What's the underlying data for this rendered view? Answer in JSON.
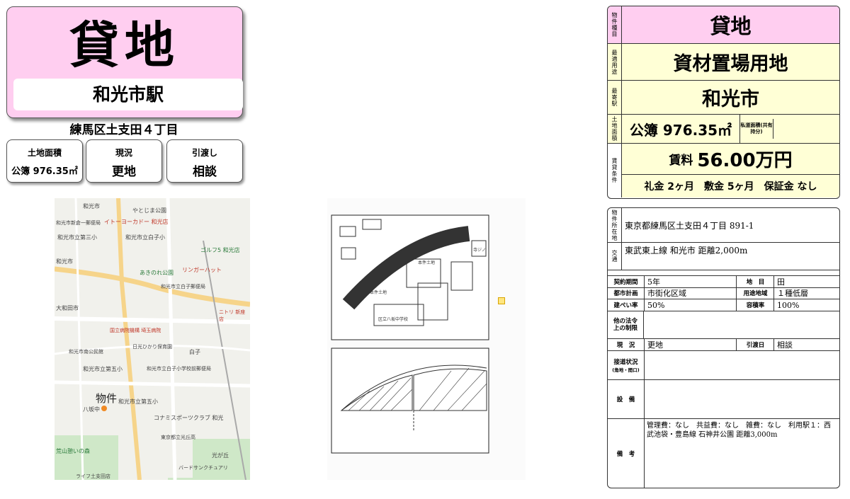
{
  "header": {
    "title": "貸地",
    "station": "和光市駅"
  },
  "address_short": "練馬区土支田４丁目",
  "cards": [
    {
      "label": "土地面積",
      "value": "公簿 976.35㎡"
    },
    {
      "label": "現況",
      "value": "更地"
    },
    {
      "label": "引渡し",
      "value": "相談"
    }
  ],
  "map": {
    "labels": [
      "和光市",
      "やとじま公園",
      "イトーヨーカドー 和光店",
      "和光市新倉一郵便局",
      "和光市立第三小",
      "和光市立白子小",
      "ゴルフ5 和光店",
      "和光市",
      "あきのれ公園",
      "リンガーハット",
      "和光市立白子郵便局",
      "大和田市",
      "ニトリ 新座店",
      "国立病院機構 埼玉病院",
      "日光ひかり保育園",
      "白子",
      "和光市立第五小",
      "和光市南公民館",
      "和光市立白子小学校前郵便局",
      "八坂中",
      "和光市立第五小",
      "コナミスポーツクラブ 和光",
      "東京都立光丘高",
      "光が丘",
      "バードサンクチュアリ",
      "荒山憩いの森",
      "ライフ土支田店"
    ],
    "property_mark": "物件"
  },
  "survey": {
    "labels": [
      "本件土地",
      "本件土地",
      "区立八坂中学校",
      "寺ジノ"
    ]
  },
  "summary": {
    "type_label": "物件種目",
    "type_value": "貸地",
    "use_label": "最適用途",
    "use_value": "資材置場用地",
    "station_label": "最寄駅",
    "station_value": "和光市",
    "area_label": "土地面積",
    "area_value": "公簿 976.35㎡",
    "private_road_label": "私道面積(共有持分)",
    "rent_label": "賃貸条件",
    "rent_prefix": "賃料",
    "rent_value": "56.00万円",
    "conditions": "礼金 2ヶ月　敷金 5ヶ月　保証金 なし"
  },
  "details": {
    "location_label": "物件所在地",
    "location_value": "東京都練馬区土支田４丁目 891-1",
    "transport_label": "交通",
    "transport_value": "東武東上線 和光市 距離2,000m",
    "contract_label": "契約期間",
    "contract_value": "5年",
    "landcat_label": "地　目",
    "landcat_value": "田",
    "cityplan_label": "都市計画",
    "cityplan_value": "市街化区域",
    "zoning_label": "用途地域",
    "zoning_value": "１種低層",
    "coverage_label": "建ぺい率",
    "coverage_value": "50%",
    "far_label": "容積率",
    "far_value": "100%",
    "other_law_label": "他の法令上の制限",
    "status_label": "現　況",
    "status_value": "更地",
    "handover_label": "引渡日",
    "handover_value": "相談",
    "road_label": "接道状況",
    "road_sub": "(角地・間口)",
    "equip_label": "設　備",
    "remarks_label": "備　考",
    "remarks_value": "管理費：なし　共益費：なし　雑費：なし　利用駅１：西武池袋・豊島線 石神井公園 距離3,000m"
  }
}
